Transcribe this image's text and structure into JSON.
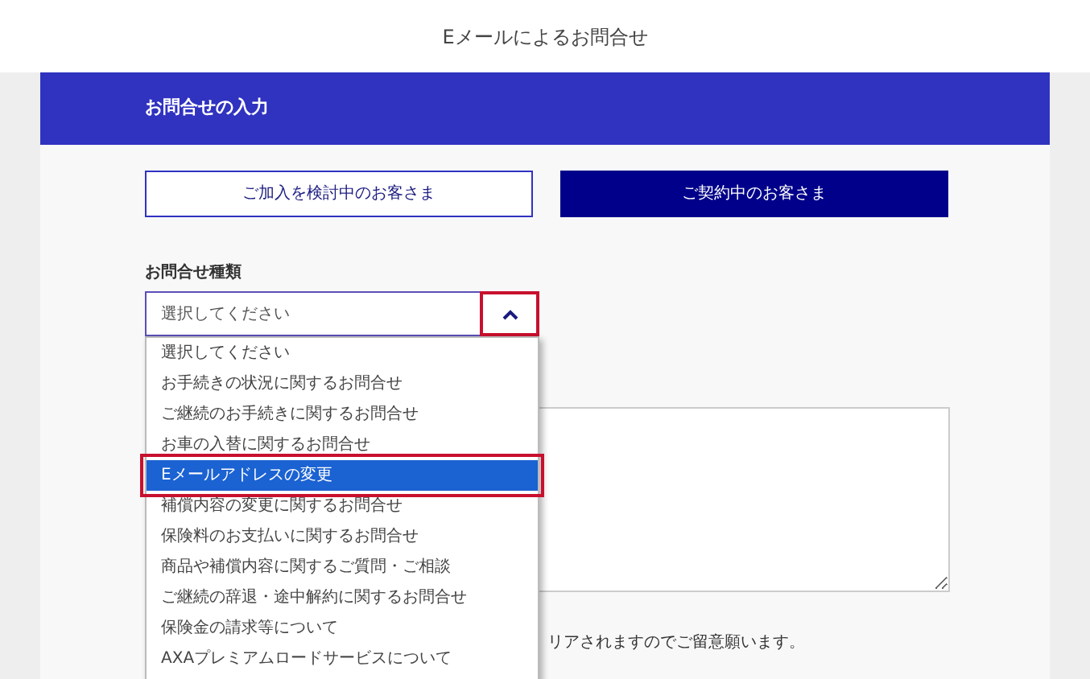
{
  "header": {
    "title": "Eメールによるお問合せ"
  },
  "section": {
    "title": "お問合せの入力"
  },
  "customer_tabs": [
    {
      "label": "ご加入を検討中のお客さま",
      "selected": false
    },
    {
      "label": "ご契約中のお客さま",
      "selected": true
    }
  ],
  "inquiry_type": {
    "label": "お問合せ種類",
    "value": "選択してください",
    "expanded": true,
    "options": [
      {
        "label": "選択してください",
        "highlighted": false
      },
      {
        "label": "お手続きの状況に関するお問合せ",
        "highlighted": false
      },
      {
        "label": "ご継続のお手続きに関するお問合せ",
        "highlighted": false
      },
      {
        "label": "お車の入替に関するお問合せ",
        "highlighted": false
      },
      {
        "label": "Eメールアドレスの変更",
        "highlighted": true
      },
      {
        "label": "補償内容の変更に関するお問合せ",
        "highlighted": false
      },
      {
        "label": "保険料のお支払いに関するお問合せ",
        "highlighted": false
      },
      {
        "label": "商品や補償内容に関するご質問・ご相談",
        "highlighted": false
      },
      {
        "label": "ご継続の辞退・途中解約に関するお問合せ",
        "highlighted": false
      },
      {
        "label": "保険金の請求等について",
        "highlighted": false
      },
      {
        "label": "AXAプレミアムロードサービスについて",
        "highlighted": false
      }
    ]
  },
  "note": "リアされますのでご留意願います。"
}
